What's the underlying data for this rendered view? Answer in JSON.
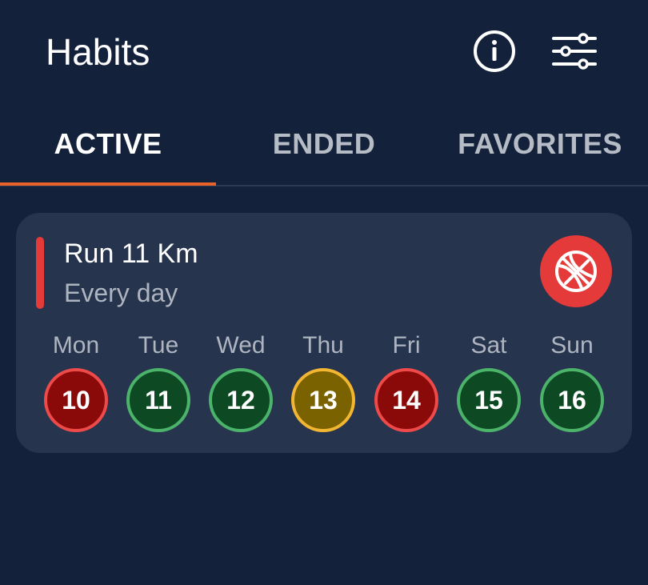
{
  "header": {
    "title": "Habits",
    "info_icon": "info-icon",
    "filter_icon": "sliders-icon"
  },
  "tabs": [
    {
      "label": "ACTIVE",
      "selected": true
    },
    {
      "label": "ENDED",
      "selected": false
    },
    {
      "label": "FAVORITES",
      "selected": false
    }
  ],
  "habit": {
    "title": "Run 11 Km",
    "frequency": "Every day",
    "accent_color": "#e53a3a",
    "icon": "basketball-icon",
    "days": [
      {
        "label": "Mon",
        "date": "10",
        "status": "failed"
      },
      {
        "label": "Tue",
        "date": "11",
        "status": "done"
      },
      {
        "label": "Wed",
        "date": "12",
        "status": "done"
      },
      {
        "label": "Thu",
        "date": "13",
        "status": "partial"
      },
      {
        "label": "Fri",
        "date": "14",
        "status": "failed"
      },
      {
        "label": "Sat",
        "date": "15",
        "status": "done"
      },
      {
        "label": "Sun",
        "date": "16",
        "status": "done"
      }
    ]
  },
  "status_colors": {
    "failed": {
      "fill": "#8a0a0a",
      "border": "#ef4a4a"
    },
    "done": {
      "fill": "#0d4a24",
      "border": "#4bb36a"
    },
    "partial": {
      "fill": "#7a6200",
      "border": "#f2b632"
    }
  },
  "theme": {
    "background": "#14213a",
    "card": "#26344e",
    "tab_indicator": "#e8622a"
  }
}
